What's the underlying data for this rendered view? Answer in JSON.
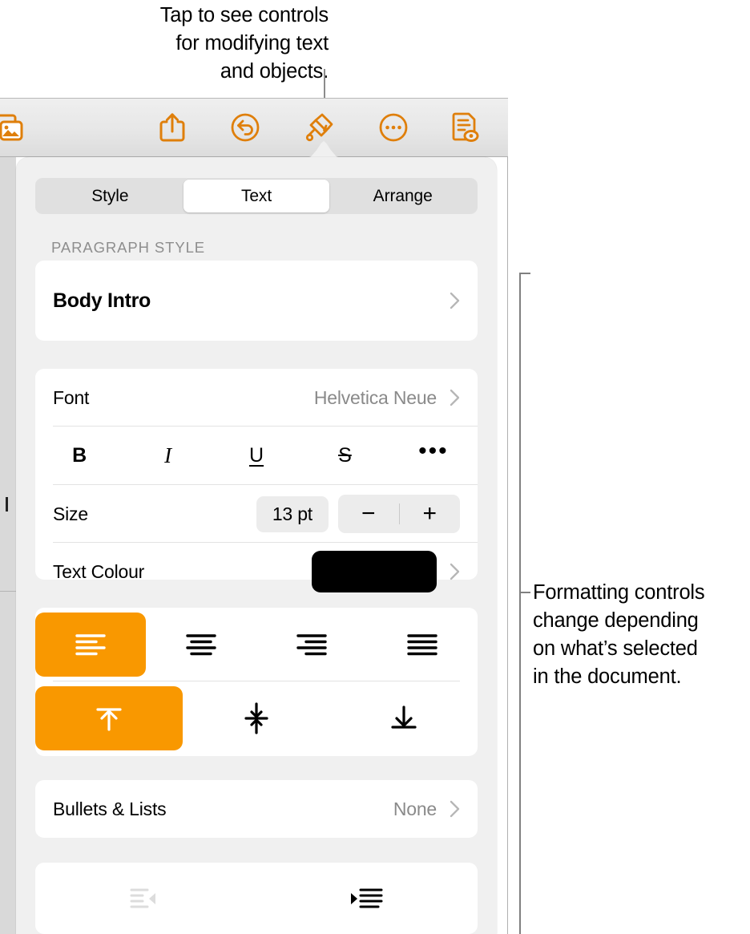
{
  "callouts": {
    "top": "Tap to see controls\nfor modifying text\nand objects.",
    "right": "Formatting controls\nchange depending\non what’s selected\nin the document."
  },
  "toolbar": {
    "items": [
      {
        "name": "insert-media-icon",
        "label": "Insert"
      },
      {
        "name": "share-icon",
        "label": "Share"
      },
      {
        "name": "undo-icon",
        "label": "Undo"
      },
      {
        "name": "format-brush-icon",
        "label": "Format"
      },
      {
        "name": "more-options-icon",
        "label": "More"
      },
      {
        "name": "document-view-icon",
        "label": "Document Options"
      }
    ],
    "accent_color": "#df7f0b"
  },
  "popover": {
    "tabs": [
      {
        "label": "Style",
        "selected": false
      },
      {
        "label": "Text",
        "selected": true
      },
      {
        "label": "Arrange",
        "selected": false
      }
    ],
    "section_header": "PARAGRAPH STYLE",
    "paragraph_style": {
      "label": "Body Intro"
    },
    "font": {
      "label": "Font",
      "value": "Helvetica Neue",
      "style_buttons": [
        {
          "name": "bold-button",
          "label": "B"
        },
        {
          "name": "italic-button",
          "label": "I"
        },
        {
          "name": "underline-button",
          "label": "U"
        },
        {
          "name": "strikethrough-button",
          "label": "S"
        },
        {
          "name": "more-text-options-button",
          "label": "•••"
        }
      ]
    },
    "size": {
      "label": "Size",
      "value": "13 pt",
      "decrease_label": "−",
      "increase_label": "+"
    },
    "text_colour": {
      "label": "Text Colour",
      "swatch_color": "#000000"
    },
    "alignment": {
      "horizontal": [
        {
          "name": "align-left-button",
          "selected": true
        },
        {
          "name": "align-center-button",
          "selected": false
        },
        {
          "name": "align-right-button",
          "selected": false
        },
        {
          "name": "align-justify-button",
          "selected": false
        }
      ],
      "vertical": [
        {
          "name": "align-top-button",
          "selected": true
        },
        {
          "name": "align-middle-button",
          "selected": false
        },
        {
          "name": "align-bottom-button",
          "selected": false
        }
      ],
      "selected_color": "#f99800"
    },
    "bullets": {
      "label": "Bullets & Lists",
      "value": "None"
    },
    "indent": [
      {
        "name": "decrease-indent-button",
        "enabled": false
      },
      {
        "name": "increase-indent-button",
        "enabled": true
      }
    ]
  }
}
